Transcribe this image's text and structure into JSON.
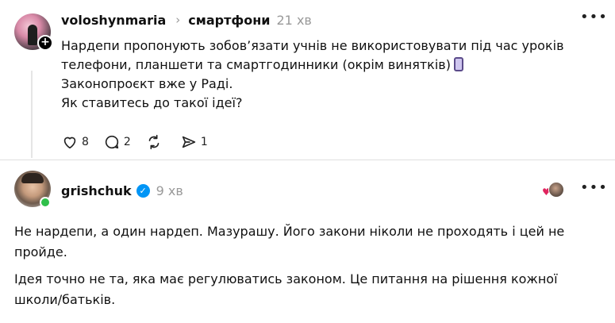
{
  "post": {
    "username": "voloshynmaria",
    "chevron": "›",
    "topic": "смартфони",
    "time": "21 хв",
    "lines": [
      "Нардепи пропонують зобов’язати учнів не використовувати під час уроків",
      "телефони, планшети та смартгодинники (окрім винятків)",
      "Законопроєкт вже у Раді.",
      "Як ставитесь до такої ідеї?"
    ],
    "emoji": "mobile-phone-emoji",
    "actions": {
      "likes": "8",
      "comments": "2",
      "reposts": "",
      "shares": "1"
    }
  },
  "reply": {
    "username": "grishchuk",
    "time": "9 хв",
    "paragraphs": [
      "Не нардепи, а один нардеп. Мазурашу. Його закони ніколи не проходять і цей не пройде.",
      "Ідея точно не та, яка має регулюватись законом. Це питання на рішення кожної школи/батьків."
    ]
  },
  "icons": {
    "more": "more-icon",
    "like": "heart-icon",
    "comment": "comment-icon",
    "repost": "repost-icon",
    "share": "share-icon",
    "verified": "verified-badge-icon",
    "follow": "plus-icon"
  },
  "colors": {
    "text": "#101010",
    "muted": "#999999",
    "verified": "#0095f6",
    "online": "#2fbf4a",
    "heart": "#e0245e"
  }
}
